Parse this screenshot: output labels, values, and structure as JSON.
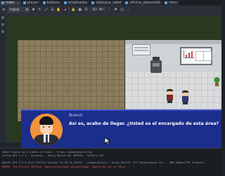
{
  "tabs": [
    {
      "label": "main",
      "color": "#5aa0e6",
      "active": true
    },
    {
      "label": "player",
      "color": "#5aa0e6"
    },
    {
      "label": "balloon",
      "color": "#5aa0e6"
    },
    {
      "label": "empleados",
      "color": "#5aa0e6"
    },
    {
      "label": "dialogue_label",
      "color": "#5aa0e6"
    },
    {
      "label": "oficina_desarrollo",
      "color": "#5aa0e6"
    },
    {
      "label": "intro",
      "color": "#5aa0e6"
    }
  ],
  "toolbar": {
    "input_label": "Input",
    "mode_2d": "2D",
    "mode_3d": "3D"
  },
  "dialog": {
    "speaker": "Nuevo",
    "text": "Así es, acabo de llegar. ¿Usted es el encargado de esta área?",
    "bg_color": "#1c2e8c",
    "portrait_color": "#f2923a"
  },
  "output": {
    "lines": [
      "Godot Engine v4.3.stable.official - https://godotengine.org",
      "Vulkan API 1.3.4 - Forward+ - Using Device #0: NVIDIA - GeForce RTX",
      "",
      "OpenGL API 3.3.0 Core Profile Context 22.20.16.201207 - Compatibility - Using Device: ATI Technologies Inc. - AMD Radeon(TM) Graphics",
      "ERROR: The Project Setting 'application/boot_splash/image' should be set to false"
    ]
  }
}
